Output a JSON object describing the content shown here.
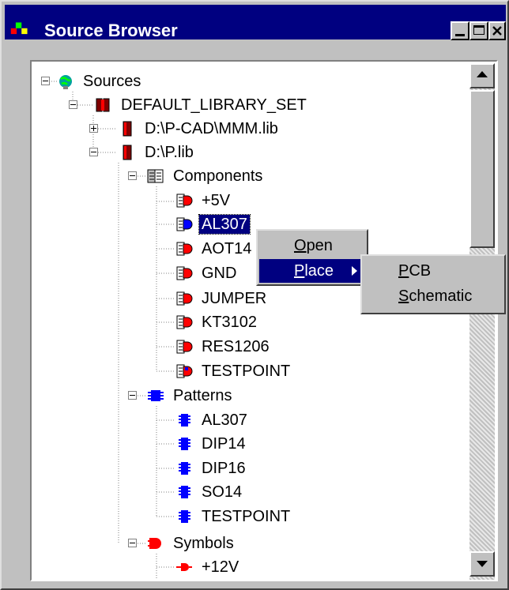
{
  "window": {
    "title": "Source Browser"
  },
  "tree": {
    "root": "Sources",
    "library_set": "DEFAULT_LIBRARY_SET",
    "libraries": [
      "D:\\P-CAD\\MMM.lib",
      "D:\\P.lib"
    ],
    "groups": {
      "components": "Components",
      "patterns": "Patterns",
      "symbols": "Symbols"
    },
    "components": [
      "+5V",
      "AL307",
      "AOT14",
      "GND",
      "JUMPER",
      "KT3102",
      "RES1206",
      "TESTPOINT"
    ],
    "patterns": [
      "AL307",
      "DIP14",
      "DIP16",
      "SO14",
      "TESTPOINT"
    ],
    "symbols": [
      "+12V"
    ],
    "selected": "AL307"
  },
  "context_menu": {
    "items": [
      {
        "label": "Open",
        "mnemonic": "O"
      },
      {
        "label": "Place",
        "mnemonic": "P"
      }
    ],
    "submenu": [
      {
        "label": "PCB",
        "mnemonic": "P"
      },
      {
        "label": "Schematic",
        "mnemonic": "S"
      }
    ]
  },
  "colors": {
    "titlebar": "#000080",
    "selection": "#000080",
    "face": "#c0c0c0",
    "component_icon": "#ff0000",
    "pattern_icon": "#0000ff"
  }
}
